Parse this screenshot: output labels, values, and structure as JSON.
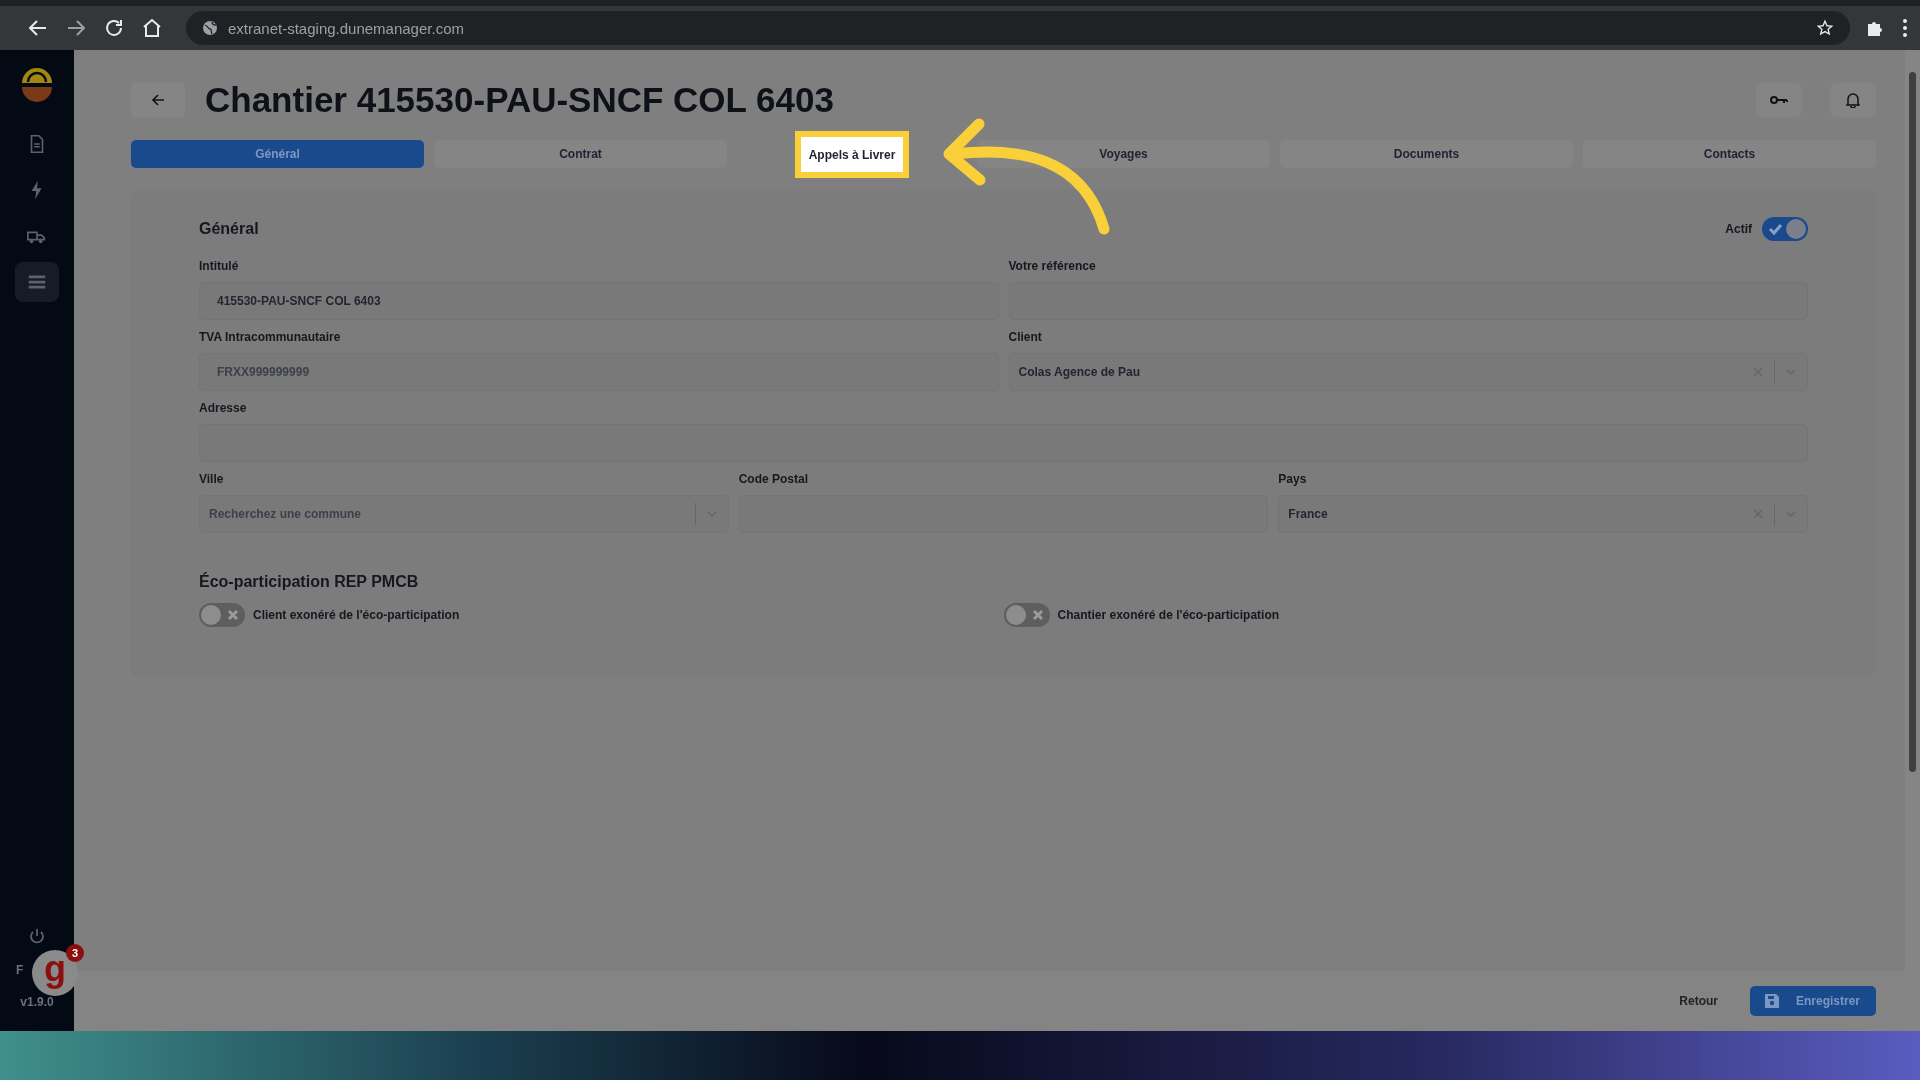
{
  "browser": {
    "url": "extranet-staging.dunemanager.com"
  },
  "sidebar": {
    "items": [
      {
        "selected": false
      },
      {
        "selected": false
      },
      {
        "selected": false
      },
      {
        "selected": true
      }
    ],
    "language": "F",
    "version": "v1.9.0"
  },
  "help_widget": {
    "letter": "g",
    "count": "3"
  },
  "header": {
    "title": "Chantier 415530-PAU-SNCF COL 6403"
  },
  "tabs": [
    {
      "label": "Général",
      "selected": true,
      "highlighted": false
    },
    {
      "label": "Contrat",
      "selected": false,
      "highlighted": false
    },
    {
      "label": "Appels à Livrer",
      "selected": false,
      "highlighted": true
    },
    {
      "label": "Voyages",
      "selected": false,
      "highlighted": false
    },
    {
      "label": "Documents",
      "selected": false,
      "highlighted": false
    },
    {
      "label": "Contacts",
      "selected": false,
      "highlighted": false
    }
  ],
  "section": {
    "title": "Général",
    "active_toggle": {
      "label": "Actif",
      "on": true
    }
  },
  "field_rows": [
    [
      {
        "kind": "text",
        "label": "Intitulé",
        "value": "415530-PAU-SNCF COL 6403"
      },
      {
        "kind": "text",
        "label": "Votre référence"
      }
    ],
    [
      {
        "kind": "text",
        "label": "TVA Intracommunautaire",
        "placeholder": "FRXX999999999"
      },
      {
        "kind": "select",
        "label": "Client",
        "value": "Colas Agence de Pau",
        "clearable": true
      }
    ],
    [
      {
        "kind": "text",
        "label": "Adresse"
      }
    ],
    [
      {
        "kind": "select",
        "label": "Ville",
        "placeholder": "Recherchez une commune",
        "clearable": false
      },
      {
        "kind": "text",
        "label": "Code Postal"
      },
      {
        "kind": "select",
        "label": "Pays",
        "value": "France",
        "clearable": true
      }
    ]
  ],
  "eco": {
    "title": "Éco-participation REP PMCB",
    "toggles": [
      {
        "label": "Client exonéré de l'éco-participation",
        "on": false
      },
      {
        "label": "Chantier exonéré de l'éco-participation",
        "on": false
      }
    ]
  },
  "footer": {
    "back": "Retour",
    "save": "Enregistrer"
  }
}
